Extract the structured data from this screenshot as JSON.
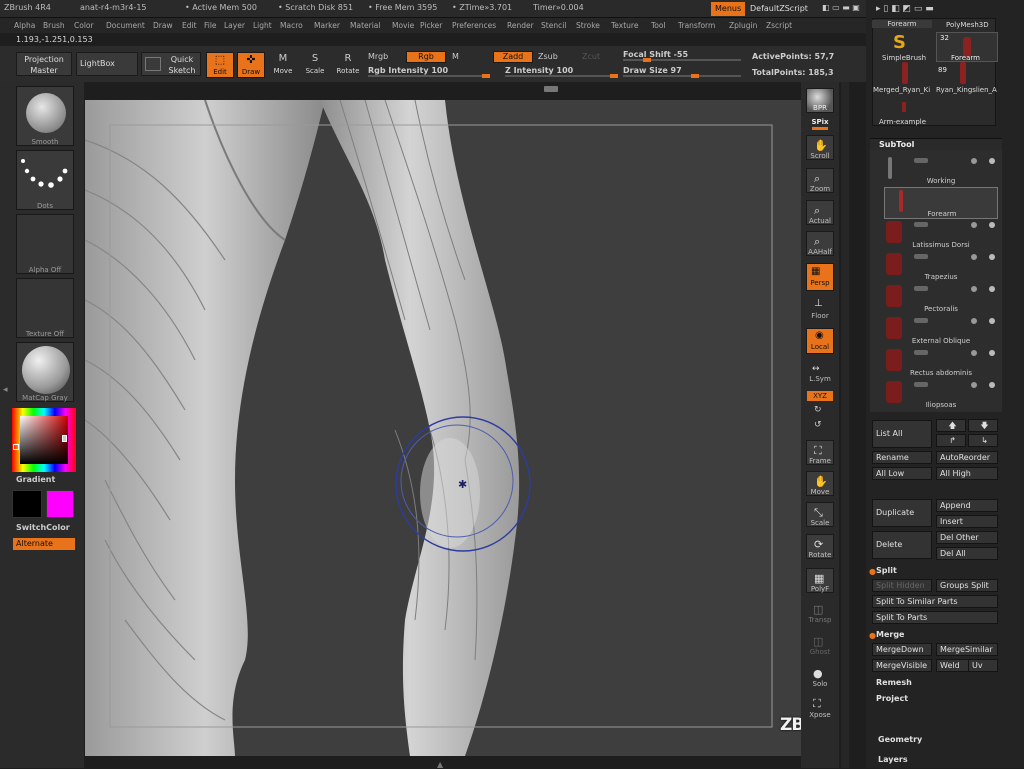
{
  "title": {
    "app": "ZBrush 4R4",
    "file": "anat-r4-m3r4-15",
    "active_mem": "• Active Mem 500",
    "scratch_disk": "• Scratch Disk 851",
    "free_mem": "• Free Mem 3595",
    "ztime": "• ZTime»3.701",
    "timer": "Timer»0.004",
    "menus_button": "Menus",
    "script_button": "DefaultZScript"
  },
  "menu_items": [
    "Alpha",
    "Brush",
    "Color",
    "Document",
    "Draw",
    "Edit",
    "File",
    "Layer",
    "Light",
    "Macro",
    "Marker",
    "Material",
    "Movie",
    "Picker",
    "Preferences",
    "Render",
    "Stencil",
    "Stroke",
    "Texture",
    "Tool",
    "Transform",
    "Zplugin",
    "Zscript"
  ],
  "coords": "1.193,-1.251,0.153",
  "toolbar": {
    "projection_master": "Projection Master",
    "lightbox": "LightBox",
    "quick_sketch": "Quick Sketch",
    "edit": "Edit",
    "draw": "Draw",
    "move": "Move",
    "scale": "Scale",
    "rotate": "Rotate",
    "mrgb": "Mrgb",
    "rgb": "Rgb",
    "m": "M",
    "rgb_intensity": "Rgb Intensity 100",
    "zadd": "Zadd",
    "zsub": "Zsub",
    "zcut": "Zcut",
    "z_intensity": "Z Intensity 100",
    "focal_shift": "Focal Shift -55",
    "draw_size": "Draw Size 97",
    "active_points": "ActivePoints: 57,7",
    "total_points": "TotalPoints: 185,3"
  },
  "left_panel": {
    "brush_label": "Smooth",
    "stroke_label": "Dots",
    "alpha_label": "Alpha Off",
    "texture_label": "Texture Off",
    "material_label": "MatCap Gray",
    "gradient": "Gradient",
    "switch_color": "SwitchColor",
    "alternate": "Alternate"
  },
  "right_strip": [
    "BPR",
    "SPix",
    "Scroll",
    "Zoom",
    "Actual",
    "AAHalf",
    "Persp",
    "Floor",
    "Local",
    "L.Sym",
    "XYZ",
    "Frame",
    "Move",
    "Scale",
    "Rotate",
    "PolyF",
    "Transp",
    "Ghost",
    "Solo",
    "Xpose"
  ],
  "tool_palette": {
    "current_tool": "Forearm",
    "polymesh": "PolyMesh3D",
    "simplebrush": "SimpleBrush",
    "count1": "32",
    "forearm2": "Forearm",
    "count2": "89",
    "merged": "Merged_Ryan_Ki",
    "ryan": "Ryan_Kingslien_A",
    "arm_example": "Arm-example"
  },
  "subtool": {
    "header": "SubTool",
    "items": [
      "Working",
      "Forearm",
      "Latissimus Dorsi",
      "Trapezius",
      "Pectoralis",
      "External Oblique",
      "Rectus abdominis",
      "Iliopsoas"
    ]
  },
  "subtool_buttons": {
    "list_all": "List All",
    "rename": "Rename",
    "autoreorder": "AutoReorder",
    "all_low": "All Low",
    "all_high": "All High",
    "duplicate": "Duplicate",
    "append": "Append",
    "insert": "Insert",
    "delete": "Delete",
    "del_other": "Del Other",
    "del_all": "Del All"
  },
  "split": {
    "header": "Split",
    "split_hidden": "Split Hidden",
    "groups_split": "Groups Split",
    "similar": "Split To Similar Parts",
    "parts": "Split To Parts"
  },
  "merge": {
    "header": "Merge",
    "merge_down": "MergeDown",
    "merge_similar": "MergeSimilar",
    "merge_visible": "MergeVisible",
    "weld": "Weld",
    "uv": "Uv"
  },
  "other_sections": {
    "remesh": "Remesh",
    "project": "Project",
    "geometry": "Geometry",
    "layers": "Layers"
  },
  "watermark": "ZBRUSH WORKSHOPS",
  "colors": {
    "accent": "#e8731a",
    "magenta": "#ff00ff",
    "brush_ring": "#2d3ca0"
  }
}
